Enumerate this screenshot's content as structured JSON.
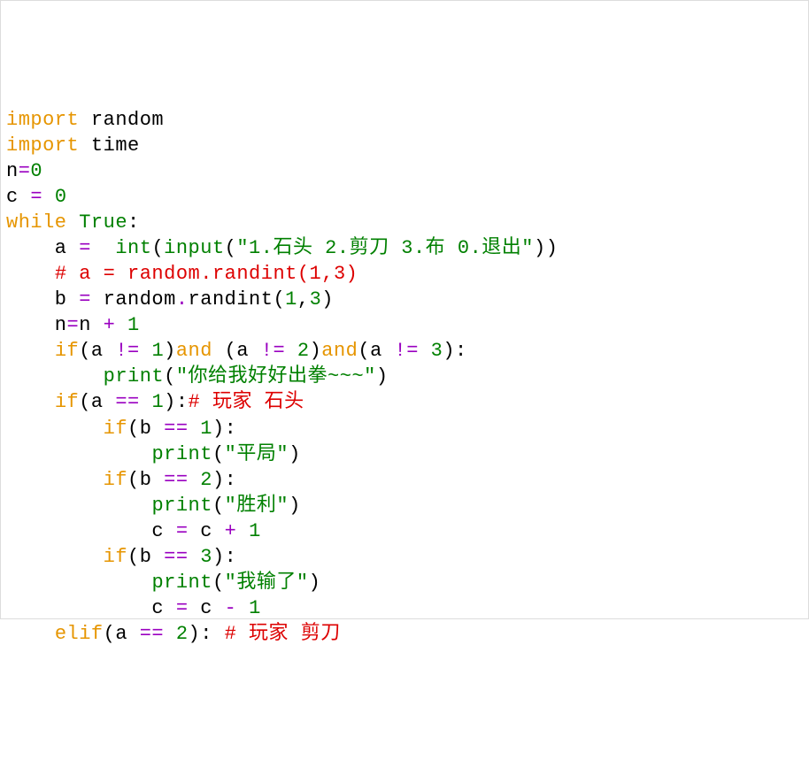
{
  "code": {
    "lines": [
      {
        "tokens": [
          {
            "t": "import",
            "c": "kw"
          },
          {
            "t": " ",
            "c": "name"
          },
          {
            "t": "random",
            "c": "name"
          }
        ]
      },
      {
        "tokens": [
          {
            "t": "import",
            "c": "kw"
          },
          {
            "t": " ",
            "c": "name"
          },
          {
            "t": "time",
            "c": "name"
          }
        ]
      },
      {
        "tokens": [
          {
            "t": "n",
            "c": "name"
          },
          {
            "t": "=",
            "c": "op"
          },
          {
            "t": "0",
            "c": "num"
          }
        ]
      },
      {
        "tokens": [
          {
            "t": "c ",
            "c": "name"
          },
          {
            "t": "=",
            "c": "op"
          },
          {
            "t": " ",
            "c": "name"
          },
          {
            "t": "0",
            "c": "num"
          }
        ]
      },
      {
        "tokens": [
          {
            "t": "while",
            "c": "kw"
          },
          {
            "t": " ",
            "c": "name"
          },
          {
            "t": "True",
            "c": "bool"
          },
          {
            "t": ":",
            "c": "punct"
          }
        ]
      },
      {
        "tokens": [
          {
            "t": "    a ",
            "c": "name"
          },
          {
            "t": "=",
            "c": "op"
          },
          {
            "t": "  ",
            "c": "name"
          },
          {
            "t": "int",
            "c": "builtin"
          },
          {
            "t": "(",
            "c": "punct"
          },
          {
            "t": "input",
            "c": "builtin"
          },
          {
            "t": "(",
            "c": "punct"
          },
          {
            "t": "\"1.石头 2.剪刀 3.布 0.退出\"",
            "c": "str"
          },
          {
            "t": "))",
            "c": "punct"
          }
        ]
      },
      {
        "tokens": [
          {
            "t": "    ",
            "c": "name"
          },
          {
            "t": "# a = random.randint(1,3)",
            "c": "comment"
          }
        ]
      },
      {
        "tokens": [
          {
            "t": "    b ",
            "c": "name"
          },
          {
            "t": "=",
            "c": "op"
          },
          {
            "t": " random",
            "c": "name"
          },
          {
            "t": ".",
            "c": "op"
          },
          {
            "t": "randint",
            "c": "name"
          },
          {
            "t": "(",
            "c": "punct"
          },
          {
            "t": "1",
            "c": "num"
          },
          {
            "t": ",",
            "c": "punct"
          },
          {
            "t": "3",
            "c": "num"
          },
          {
            "t": ")",
            "c": "punct"
          }
        ]
      },
      {
        "tokens": [
          {
            "t": "    n",
            "c": "name"
          },
          {
            "t": "=",
            "c": "op"
          },
          {
            "t": "n ",
            "c": "name"
          },
          {
            "t": "+",
            "c": "op"
          },
          {
            "t": " ",
            "c": "name"
          },
          {
            "t": "1",
            "c": "num"
          }
        ]
      },
      {
        "tokens": [
          {
            "t": "    ",
            "c": "name"
          },
          {
            "t": "if",
            "c": "kw"
          },
          {
            "t": "(a ",
            "c": "punct"
          },
          {
            "t": "!=",
            "c": "op"
          },
          {
            "t": " ",
            "c": "name"
          },
          {
            "t": "1",
            "c": "num"
          },
          {
            "t": ")",
            "c": "punct"
          },
          {
            "t": "and",
            "c": "kw"
          },
          {
            "t": " (a ",
            "c": "punct"
          },
          {
            "t": "!=",
            "c": "op"
          },
          {
            "t": " ",
            "c": "name"
          },
          {
            "t": "2",
            "c": "num"
          },
          {
            "t": ")",
            "c": "punct"
          },
          {
            "t": "and",
            "c": "kw"
          },
          {
            "t": "(a ",
            "c": "punct"
          },
          {
            "t": "!=",
            "c": "op"
          },
          {
            "t": " ",
            "c": "name"
          },
          {
            "t": "3",
            "c": "num"
          },
          {
            "t": "):",
            "c": "punct"
          }
        ]
      },
      {
        "tokens": [
          {
            "t": "        ",
            "c": "name"
          },
          {
            "t": "print",
            "c": "builtin"
          },
          {
            "t": "(",
            "c": "punct"
          },
          {
            "t": "\"你给我好好出拳~~~\"",
            "c": "str"
          },
          {
            "t": ")",
            "c": "punct"
          }
        ]
      },
      {
        "tokens": [
          {
            "t": "    ",
            "c": "name"
          },
          {
            "t": "if",
            "c": "kw"
          },
          {
            "t": "(a ",
            "c": "punct"
          },
          {
            "t": "==",
            "c": "op"
          },
          {
            "t": " ",
            "c": "name"
          },
          {
            "t": "1",
            "c": "num"
          },
          {
            "t": "):",
            "c": "punct"
          },
          {
            "t": "# 玩家 石头",
            "c": "comment"
          }
        ]
      },
      {
        "tokens": [
          {
            "t": "        ",
            "c": "name"
          },
          {
            "t": "if",
            "c": "kw"
          },
          {
            "t": "(b ",
            "c": "punct"
          },
          {
            "t": "==",
            "c": "op"
          },
          {
            "t": " ",
            "c": "name"
          },
          {
            "t": "1",
            "c": "num"
          },
          {
            "t": "):",
            "c": "punct"
          }
        ]
      },
      {
        "tokens": [
          {
            "t": "            ",
            "c": "name"
          },
          {
            "t": "print",
            "c": "builtin"
          },
          {
            "t": "(",
            "c": "punct"
          },
          {
            "t": "\"平局\"",
            "c": "str"
          },
          {
            "t": ")",
            "c": "punct"
          }
        ]
      },
      {
        "tokens": [
          {
            "t": "        ",
            "c": "name"
          },
          {
            "t": "if",
            "c": "kw"
          },
          {
            "t": "(b ",
            "c": "punct"
          },
          {
            "t": "==",
            "c": "op"
          },
          {
            "t": " ",
            "c": "name"
          },
          {
            "t": "2",
            "c": "num"
          },
          {
            "t": "):",
            "c": "punct"
          }
        ]
      },
      {
        "tokens": [
          {
            "t": "            ",
            "c": "name"
          },
          {
            "t": "print",
            "c": "builtin"
          },
          {
            "t": "(",
            "c": "punct"
          },
          {
            "t": "\"胜利\"",
            "c": "str"
          },
          {
            "t": ")",
            "c": "punct"
          }
        ]
      },
      {
        "tokens": [
          {
            "t": "            c ",
            "c": "name"
          },
          {
            "t": "=",
            "c": "op"
          },
          {
            "t": " c ",
            "c": "name"
          },
          {
            "t": "+",
            "c": "op"
          },
          {
            "t": " ",
            "c": "name"
          },
          {
            "t": "1",
            "c": "num"
          }
        ]
      },
      {
        "tokens": [
          {
            "t": "        ",
            "c": "name"
          },
          {
            "t": "if",
            "c": "kw"
          },
          {
            "t": "(b ",
            "c": "punct"
          },
          {
            "t": "==",
            "c": "op"
          },
          {
            "t": " ",
            "c": "name"
          },
          {
            "t": "3",
            "c": "num"
          },
          {
            "t": "):",
            "c": "punct"
          }
        ]
      },
      {
        "tokens": [
          {
            "t": "            ",
            "c": "name"
          },
          {
            "t": "print",
            "c": "builtin"
          },
          {
            "t": "(",
            "c": "punct"
          },
          {
            "t": "\"我输了\"",
            "c": "str"
          },
          {
            "t": ")",
            "c": "punct"
          }
        ]
      },
      {
        "tokens": [
          {
            "t": "            c ",
            "c": "name"
          },
          {
            "t": "=",
            "c": "op"
          },
          {
            "t": " c ",
            "c": "name"
          },
          {
            "t": "-",
            "c": "op"
          },
          {
            "t": " ",
            "c": "name"
          },
          {
            "t": "1",
            "c": "num"
          }
        ]
      },
      {
        "tokens": [
          {
            "t": "    ",
            "c": "name"
          },
          {
            "t": "elif",
            "c": "kw"
          },
          {
            "t": "(a ",
            "c": "punct"
          },
          {
            "t": "==",
            "c": "op"
          },
          {
            "t": " ",
            "c": "name"
          },
          {
            "t": "2",
            "c": "num"
          },
          {
            "t": "): ",
            "c": "punct"
          },
          {
            "t": "# 玩家 剪刀",
            "c": "comment"
          }
        ]
      }
    ]
  }
}
